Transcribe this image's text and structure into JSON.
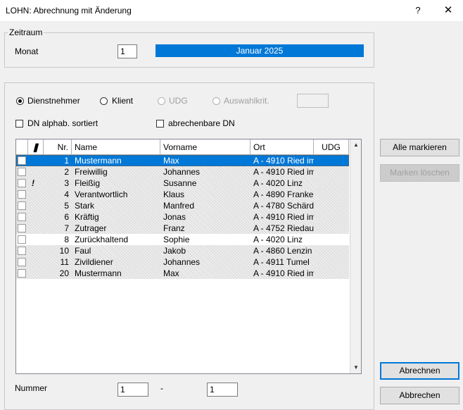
{
  "window": {
    "title": "LOHN: Abrechnung mit Änderung",
    "help": "?",
    "close": "✕"
  },
  "zeitraum": {
    "label": "Zeitraum",
    "monat_label": "Monat",
    "monat_value": "1",
    "period_display": "Januar  2025"
  },
  "filter": {
    "radio_dienstnehmer": "Dienstnehmer",
    "radio_klient": "Klient",
    "radio_udg": "UDG",
    "radio_auswahl": "Auswahlkrit.",
    "check_alphab": "DN alphab. sortiert",
    "check_abrechenbar": "abrechenbare DN"
  },
  "table": {
    "headers": {
      "mark": "",
      "nr": "Nr.",
      "name": "Name",
      "vorname": "Vorname",
      "ort": "Ort",
      "udg": "UDG"
    },
    "rows": [
      {
        "nr": "1",
        "name": "Mustermann",
        "vorname": "Max",
        "ort": "A - 4910 Ried im",
        "flag": ""
      },
      {
        "nr": "2",
        "name": "Freiwillig",
        "vorname": "Johannes",
        "ort": "A - 4910 Ried im",
        "flag": ""
      },
      {
        "nr": "3",
        "name": "Fleißig",
        "vorname": "Susanne",
        "ort": "A - 4020 Linz",
        "flag": "!"
      },
      {
        "nr": "4",
        "name": "Verantwortlich",
        "vorname": "Klaus",
        "ort": "A - 4890 Franke",
        "flag": ""
      },
      {
        "nr": "5",
        "name": "Stark",
        "vorname": "Manfred",
        "ort": "A - 4780 Schärd",
        "flag": ""
      },
      {
        "nr": "6",
        "name": "Kräftig",
        "vorname": "Jonas",
        "ort": "A - 4910 Ried im",
        "flag": ""
      },
      {
        "nr": "7",
        "name": "Zutrager",
        "vorname": "Franz",
        "ort": "A - 4752 Riedau",
        "flag": ""
      },
      {
        "nr": "8",
        "name": "Zurückhaltend",
        "vorname": "Sophie",
        "ort": "A - 4020 Linz",
        "flag": ""
      },
      {
        "nr": "10",
        "name": "Faul",
        "vorname": "Jakob",
        "ort": "A - 4860 Lenzin",
        "flag": ""
      },
      {
        "nr": "11",
        "name": "Zivildiener",
        "vorname": "Johannes",
        "ort": "A - 4911 Tumel",
        "flag": ""
      },
      {
        "nr": "20",
        "name": "Mustermann",
        "vorname": "Max",
        "ort": "A - 4910 Ried im",
        "flag": ""
      }
    ]
  },
  "buttons": {
    "alle_markieren": "Alle markieren",
    "marken_loeschen": "Marken löschen",
    "abrechnen": "Abrechnen",
    "abbrechen": "Abbrechen"
  },
  "nummer": {
    "label": "Nummer",
    "from": "1",
    "dash": "-",
    "to": "1"
  },
  "colors": {
    "accent": "#0078d7",
    "background": "#f0f0f0"
  }
}
